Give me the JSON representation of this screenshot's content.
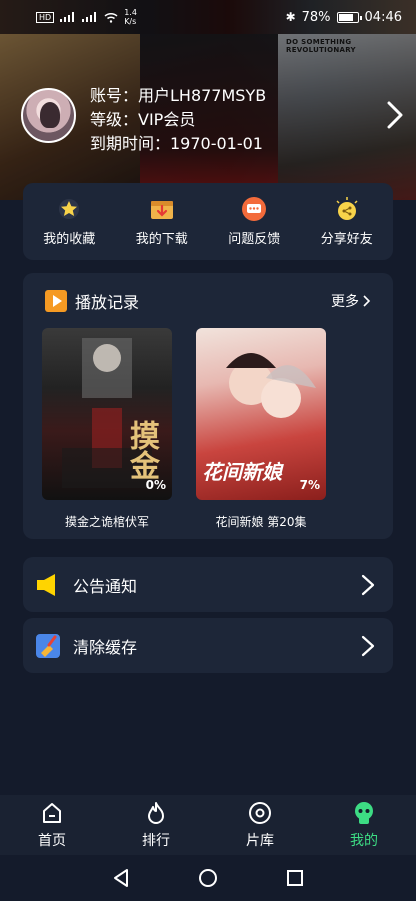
{
  "status_bar": {
    "network_speed": "1.4\nK/s",
    "battery": "78%",
    "time": "04:46"
  },
  "banner": {
    "poster_text": "DO SOMETHING REVOLUTIONARY",
    "account_label": "账号：用户LH877MSYB",
    "level_label": "等级：VIP会员",
    "expiry_label": "到期时间：1970-01-01"
  },
  "actions": [
    {
      "label": "我的收藏",
      "icon": "star-icon"
    },
    {
      "label": "我的下载",
      "icon": "download-icon"
    },
    {
      "label": "问题反馈",
      "icon": "feedback-icon"
    },
    {
      "label": "分享好友",
      "icon": "share-icon"
    }
  ],
  "history": {
    "title": "播放记录",
    "more": "更多",
    "items": [
      {
        "title": "摸金之诡棺伏军",
        "progress_text": "0%",
        "cover_text": "摸金"
      },
      {
        "title": "花间新娘 第20集",
        "progress_text": "7%",
        "cover_text": "花间新娘"
      }
    ]
  },
  "menu": {
    "notice": "公告通知",
    "clear_cache": "清除缓存"
  },
  "bottom_nav": [
    {
      "label": "首页",
      "icon": "home-icon"
    },
    {
      "label": "排行",
      "icon": "fire-icon"
    },
    {
      "label": "片库",
      "icon": "library-icon"
    },
    {
      "label": "我的",
      "icon": "profile-icon",
      "active": true
    }
  ],
  "colors": {
    "accent": "#3ddc84",
    "card": "#1d2638",
    "background": "#141b2b"
  }
}
